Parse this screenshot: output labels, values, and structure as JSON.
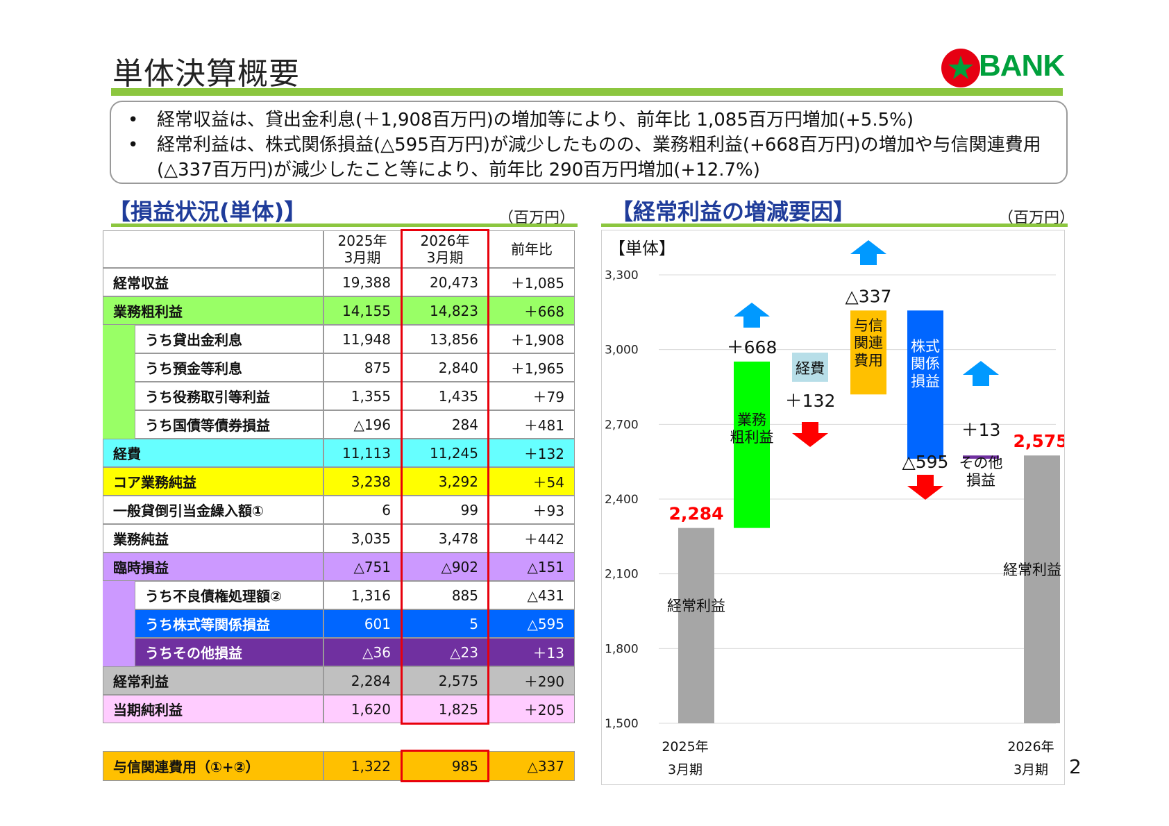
{
  "title": "単体決算概要",
  "logo": {
    "text": "BANK",
    "colors": {
      "sun": "#e60012",
      "text": "#00a03c"
    }
  },
  "summary": {
    "bullet": "•",
    "lines": [
      "経常収益は、貸出金利息(＋1,908百万円)の増加等により、前年比 1,085百万円増加(+5.5%)",
      "経常利益は、株式関係損益(△595百万円)が減少したものの、業務粗利益(+668百万円)の増加や与信関連費用",
      "(△337百万円)が減少したこと等により、前年比 290百万円増加(+12.7%)"
    ]
  },
  "table_section": {
    "title": "【損益状況(単体)】",
    "unit": "（百万円）"
  },
  "table": {
    "headers": {
      "label": "",
      "y2025": "2025年\n3月期",
      "y2026": "2026年\n3月期",
      "diff": "前年比"
    },
    "rows": [
      {
        "label": "経常収益",
        "v1": "19,388",
        "v2": "20,473",
        "d": "＋1,085",
        "indent": false,
        "bg": "#ffffff",
        "fg": "#111111"
      },
      {
        "label": "業務粗利益",
        "v1": "14,155",
        "v2": "14,823",
        "d": "＋668",
        "indent": false,
        "bg": "#99ff66",
        "fg": "#111111"
      },
      {
        "label": "うち貸出金利息",
        "v1": "11,948",
        "v2": "13,856",
        "d": "＋1,908",
        "indent": true,
        "bg": "#ffffff",
        "fg": "#111111",
        "band": "#99ff66"
      },
      {
        "label": "うち預金等利息",
        "v1": "875",
        "v2": "2,840",
        "d": "＋1,965",
        "indent": true,
        "bg": "#ffffff",
        "fg": "#111111",
        "band": "#99ff66"
      },
      {
        "label": "うち役務取引等利益",
        "v1": "1,355",
        "v2": "1,435",
        "d": "＋79",
        "indent": true,
        "bg": "#ffffff",
        "fg": "#111111",
        "band": "#99ff66"
      },
      {
        "label": "うち国債等債券損益",
        "v1": "△196",
        "v2": "284",
        "d": "＋481",
        "indent": true,
        "bg": "#ffffff",
        "fg": "#111111",
        "band": "#99ff66"
      },
      {
        "label": "経費",
        "v1": "11,113",
        "v2": "11,245",
        "d": "＋132",
        "indent": false,
        "bg": "#66ffff",
        "fg": "#111111"
      },
      {
        "label": "コア業務純益",
        "v1": "3,238",
        "v2": "3,292",
        "d": "＋54",
        "indent": false,
        "bg": "#ffff00",
        "fg": "#111111"
      },
      {
        "label": "一般貸倒引当金繰入額①",
        "v1": "6",
        "v2": "99",
        "d": "＋93",
        "indent": false,
        "bg": "#ffffff",
        "fg": "#111111"
      },
      {
        "label": "業務純益",
        "v1": "3,035",
        "v2": "3,478",
        "d": "＋442",
        "indent": false,
        "bg": "#ffffff",
        "fg": "#111111"
      },
      {
        "label": "臨時損益",
        "v1": "△751",
        "v2": "△902",
        "d": "△151",
        "indent": false,
        "bg": "#cc99ff",
        "fg": "#111111"
      },
      {
        "label": "うち不良債権処理額②",
        "v1": "1,316",
        "v2": "885",
        "d": "△431",
        "indent": true,
        "bg": "#ffffff",
        "fg": "#111111",
        "band": "#cc99ff"
      },
      {
        "label": "うち株式等関係損益",
        "v1": "601",
        "v2": "5",
        "d": "△595",
        "indent": true,
        "bg": "#0066ff",
        "fg": "#ffffff",
        "band": "#cc99ff"
      },
      {
        "label": "うちその他損益",
        "v1": "△36",
        "v2": "△23",
        "d": "＋13",
        "indent": true,
        "bg": "#7030a0",
        "fg": "#ffffff",
        "band": "#cc99ff"
      },
      {
        "label": "経常利益",
        "v1": "2,284",
        "v2": "2,575",
        "d": "＋290",
        "indent": false,
        "bg": "#c0c0c0",
        "fg": "#111111"
      },
      {
        "label": "当期純利益",
        "v1": "1,620",
        "v2": "1,825",
        "d": "＋205",
        "indent": false,
        "bg": "#ffccff",
        "fg": "#111111"
      }
    ],
    "footer": {
      "label": "与信関連費用（①+②）",
      "v1": "1,322",
      "v2": "985",
      "d": "△337",
      "bg": "#ffc000"
    }
  },
  "chart_section": {
    "title": "【経常利益の増減要因】",
    "unit": "（百万円）"
  },
  "chart_data": {
    "type": "bar",
    "subtitle": "【単体】",
    "ylim": [
      1500,
      3300
    ],
    "yticks": [
      "1,500",
      "1,800",
      "2,100",
      "2,400",
      "2,700",
      "3,000",
      "3,300"
    ],
    "ytick_values": [
      1500,
      1800,
      2100,
      2400,
      2700,
      3000,
      3300
    ],
    "grid": true,
    "bars": [
      {
        "label": "経常利益",
        "bottom": 1500,
        "top": 2284,
        "color": "#a6a6a6",
        "value_label": "2,284",
        "value_color": "#ff0000",
        "arrow": "none"
      },
      {
        "label": "業務\n粗利益",
        "bottom": 2284,
        "top": 2952,
        "color": "#00ff00",
        "value_label": "＋668",
        "value_color": "#111111",
        "arrow": "up"
      },
      {
        "label": "経費",
        "bottom": 2820,
        "top": 2952,
        "color": "none",
        "value_label": "＋132",
        "value_color": "#111111",
        "arrow": "down"
      },
      {
        "label": "与信\n関連\n費用",
        "bottom": 2820,
        "top": 3157,
        "color": "#ffc000",
        "value_label": "△337",
        "value_color": "#111111",
        "arrow": "up"
      },
      {
        "label": "株式\n関係\n損益",
        "bottom": 2562,
        "top": 3157,
        "color": "#0066ff",
        "value_label": "△595",
        "value_color": "#111111",
        "arrow": "down"
      },
      {
        "label": "その他\n損益",
        "bottom": 2562,
        "top": 2575,
        "color": "#7030a0",
        "value_label": "＋13",
        "value_color": "#111111",
        "arrow": "up"
      },
      {
        "label": "経常利益",
        "bottom": 1500,
        "top": 2575,
        "color": "#a6a6a6",
        "value_label": "2,575",
        "value_color": "#ff0000",
        "arrow": "none"
      }
    ],
    "x_labels": [
      {
        "year": "2025年",
        "period": "3月期"
      },
      {
        "year": "2026年",
        "period": "3月期"
      }
    ],
    "colors": {
      "arrow_up": "#0099ff",
      "arrow_down": "#ff0000",
      "keihi_box": "#b7dee8",
      "grid": "#d9d9d9"
    }
  },
  "page_number": "2"
}
